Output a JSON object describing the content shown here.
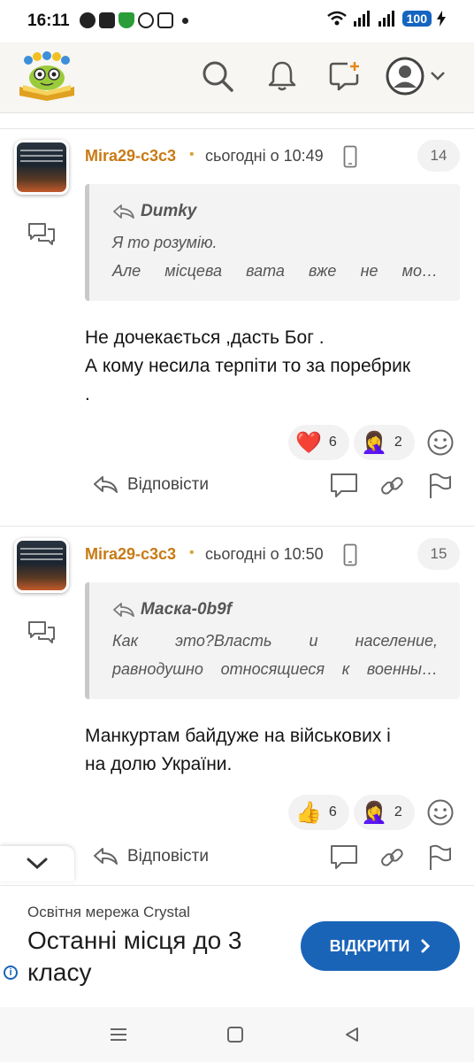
{
  "status_bar": {
    "time": "16:11",
    "battery": "100",
    "icons": [
      "telegram-icon",
      "facebook-icon",
      "shield-icon",
      "viber-icon",
      "calendar-icon",
      "dot-icon",
      "wifi-icon",
      "signal-icon",
      "signal-icon",
      "charging-icon"
    ]
  },
  "header": {
    "icons": [
      "search-icon",
      "bell-icon",
      "new-message-icon",
      "user-avatar-icon",
      "chevron-down-icon"
    ]
  },
  "posts": [
    {
      "author": "Mira29-c3c3",
      "separator": "•",
      "time": "сьогодні о 10:49",
      "number": "14",
      "quote": {
        "author": "Dumky",
        "line1": "Я то розумію.",
        "line2": "Але місцева вата вже не мо…"
      },
      "body_line1": "Не дочекається ,дасть Бог .",
      "body_line2": "А кому несила терпіти то за поребрик",
      "body_line3": ".",
      "reactions": [
        {
          "emoji": "❤️",
          "count": "6"
        },
        {
          "emoji": "🤦‍♀️",
          "count": "2"
        }
      ],
      "reply_label": "Відповісти"
    },
    {
      "author": "Mira29-c3c3",
      "separator": "•",
      "time": "сьогодні о 10:50",
      "number": "15",
      "quote": {
        "author": "Маска-0b9f",
        "line1": "Как это?Власть и население,",
        "line2": "равнодушно относящиеся к военны…"
      },
      "body_line1": "Манкуртам байдуже на військових і",
      "body_line2": "на долю України.",
      "reactions": [
        {
          "emoji": "👍",
          "count": "6"
        },
        {
          "emoji": "🤦‍♀️",
          "count": "2"
        }
      ],
      "reply_label": "Відповісти"
    }
  ],
  "ad": {
    "sponsor": "Освітня мережа Crystal",
    "title": "Останні місця до 3 класу",
    "button": "ВІДКРИТИ",
    "info": "i"
  },
  "colors": {
    "author": "#c87a14",
    "ad_button": "#1a64b8",
    "header_bg": "#f7f6f2",
    "quote_bg": "#f3f3f3"
  }
}
